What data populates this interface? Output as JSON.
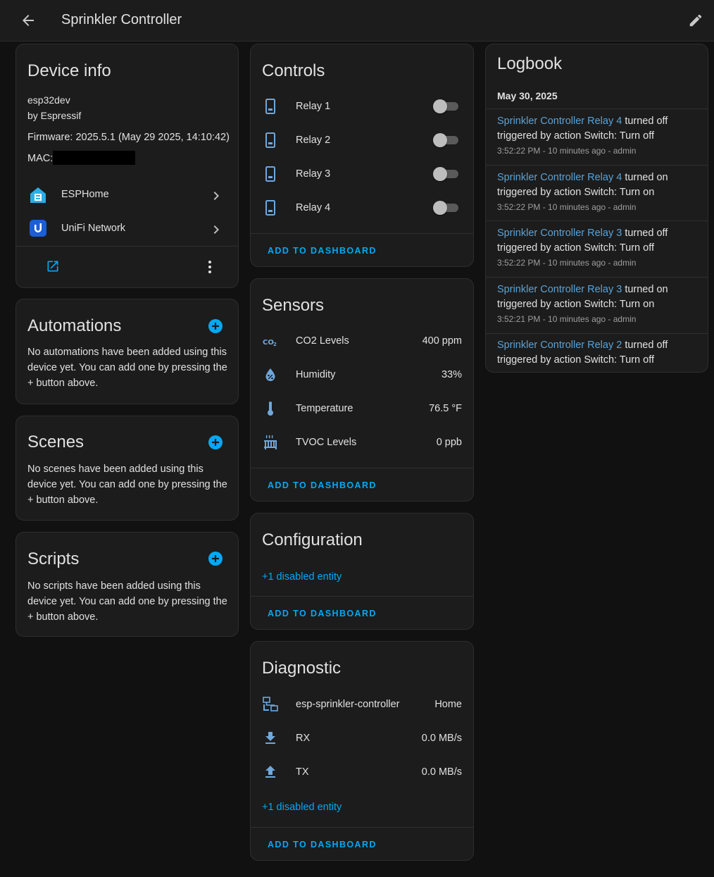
{
  "header": {
    "title": "Sprinkler Controller"
  },
  "device_info": {
    "title": "Device info",
    "model": "esp32dev",
    "manufacturer": "by Espressif",
    "firmware": "Firmware: 2025.5.1 (May 29 2025, 14:10:42)",
    "mac_label": "MAC:",
    "integrations": [
      {
        "label": "ESPHome",
        "icon": "esphome-icon"
      },
      {
        "label": "UniFi Network",
        "icon": "unifi-icon"
      }
    ]
  },
  "automations": {
    "title": "Automations",
    "text": "No automations have been added using this device yet. You can add one by pressing the + button above."
  },
  "scenes": {
    "title": "Scenes",
    "text": "No scenes have been added using this device yet. You can add one by pressing the + button above."
  },
  "scripts": {
    "title": "Scripts",
    "text": "No scripts have been added using this device yet. You can add one by pressing the + button above."
  },
  "controls": {
    "title": "Controls",
    "items": [
      {
        "label": "Relay 1",
        "state": "off"
      },
      {
        "label": "Relay 2",
        "state": "off"
      },
      {
        "label": "Relay 3",
        "state": "off"
      },
      {
        "label": "Relay 4",
        "state": "off"
      }
    ],
    "add_label": "ADD TO DASHBOARD"
  },
  "sensors": {
    "title": "Sensors",
    "items": [
      {
        "label": "CO2 Levels",
        "value": "400 ppm",
        "icon": "co2-icon"
      },
      {
        "label": "Humidity",
        "value": "33%",
        "icon": "humidity-icon"
      },
      {
        "label": "Temperature",
        "value": "76.5 °F",
        "icon": "thermometer-icon"
      },
      {
        "label": "TVOC Levels",
        "value": "0 ppb",
        "icon": "radiator-icon"
      }
    ],
    "add_label": "ADD TO DASHBOARD"
  },
  "configuration": {
    "title": "Configuration",
    "disabled": "+1 disabled entity",
    "add_label": "ADD TO DASHBOARD"
  },
  "diagnostic": {
    "title": "Diagnostic",
    "items": [
      {
        "label": "esp-sprinkler-controller",
        "value": "Home",
        "icon": "network-icon"
      },
      {
        "label": "RX",
        "value": "0.0 MB/s",
        "icon": "download-icon"
      },
      {
        "label": "TX",
        "value": "0.0 MB/s",
        "icon": "upload-icon"
      }
    ],
    "disabled": "+1 disabled entity",
    "add_label": "ADD TO DASHBOARD"
  },
  "logbook": {
    "title": "Logbook",
    "date": "May 30, 2025",
    "entries": [
      {
        "entity": "Sprinkler Controller Relay 4",
        "action": " turned off",
        "trigger": "triggered by action Switch: Turn off",
        "time": "3:52:22 PM - 10 minutes ago - admin"
      },
      {
        "entity": "Sprinkler Controller Relay 4",
        "action": " turned on",
        "trigger": "triggered by action Switch: Turn on",
        "time": "3:52:22 PM - 10 minutes ago - admin"
      },
      {
        "entity": "Sprinkler Controller Relay 3",
        "action": " turned off",
        "trigger": "triggered by action Switch: Turn off",
        "time": "3:52:22 PM - 10 minutes ago - admin"
      },
      {
        "entity": "Sprinkler Controller Relay 3",
        "action": " turned on",
        "trigger": "triggered by action Switch: Turn on",
        "time": "3:52:21 PM - 10 minutes ago - admin"
      },
      {
        "entity": "Sprinkler Controller Relay 2",
        "action": " turned off",
        "trigger": "triggered by action Switch: Turn off",
        "time": ""
      }
    ]
  },
  "colors": {
    "accent": "#03a9f4",
    "entity_link": "#5aa2d6",
    "card_bg": "#1c1c1c",
    "page_bg": "#111111"
  }
}
